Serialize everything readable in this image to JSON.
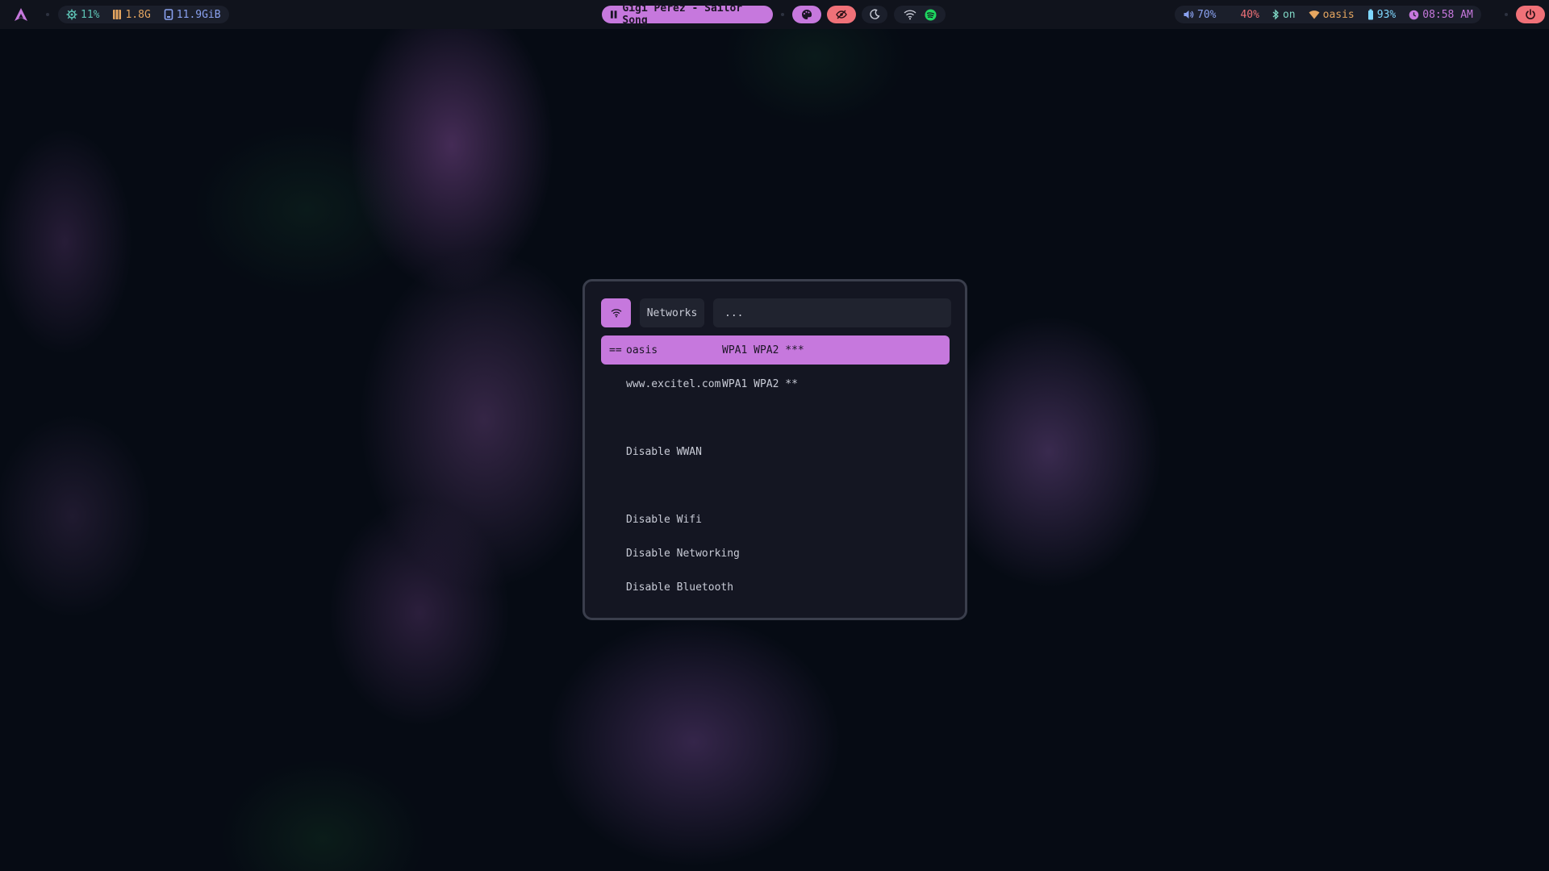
{
  "bar": {
    "cpu": "11%",
    "memory": "1.8G",
    "disk": "11.9GiB",
    "media": "Gigi Perez - Sailor Song",
    "volume": "70%",
    "brightness": "40%",
    "bluetooth": "on",
    "network": "oasis",
    "battery": "93%",
    "clock": "08:58 AM"
  },
  "menu": {
    "prompt": "Networks",
    "query": "...",
    "entries": [
      {
        "mark": "==",
        "ssid": "oasis",
        "security": "WPA1 WPA2 ***"
      },
      {
        "mark": "",
        "ssid": "www.excitel.com",
        "security": "WPA1 WPA2 **"
      },
      {
        "mark": "",
        "ssid": "",
        "security": ""
      },
      {
        "mark": "",
        "ssid": "Disable WWAN",
        "security": ""
      },
      {
        "mark": "",
        "ssid": "",
        "security": ""
      },
      {
        "mark": "",
        "ssid": "",
        "security": ""
      },
      {
        "mark": "",
        "ssid": "Disable Wifi",
        "security": ""
      },
      {
        "mark": "",
        "ssid": "Disable Networking",
        "security": ""
      },
      {
        "mark": "",
        "ssid": "Disable Bluetooth",
        "security": ""
      }
    ]
  },
  "colors": {
    "accent": "#c678dd",
    "cpu": "#5ec4b6",
    "memory": "#e5a660",
    "disk": "#8aa2f0",
    "brightness": "#f07178",
    "bluetooth": "#7fd7c5",
    "network": "#e5a660",
    "battery": "#7fd7ff",
    "clock": "#c678dd",
    "power": "#f07178",
    "spotify": "#1ed760"
  },
  "icons": [
    "arch-logo-icon",
    "cpu-icon",
    "memory-icon",
    "disk-icon",
    "pause-icon",
    "palette-icon",
    "eye-off-icon",
    "moon-icon",
    "wifi-icon",
    "spotify-icon",
    "volume-icon",
    "brightness-icon",
    "bluetooth-icon",
    "network-icon",
    "battery-icon",
    "clock-icon",
    "power-icon"
  ]
}
